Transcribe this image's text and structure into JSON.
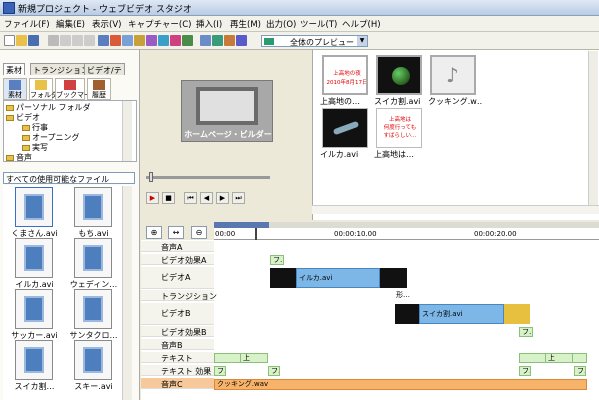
{
  "window": {
    "title": "新規プロジェクト - ウェブビデオ スタジオ"
  },
  "menu": [
    "ファイル(F)",
    "編集(E)",
    "表示(V)",
    "キャプチャー(C)",
    "挿入(I)",
    "再生(M)",
    "出力(O)",
    "ツール(T)",
    "ヘルプ(H)"
  ],
  "toolbar": {
    "preview_select": "全体のプレビュー"
  },
  "left_panel": {
    "tabs": [
      "素材",
      "トランジション",
      "ビデオ/テ"
    ],
    "categories": [
      "素材",
      "フォルダ",
      "ブックマーク",
      "履歴"
    ],
    "tree": [
      "パーソナル フォルダ",
      "ビデオ",
      "行事",
      "オープニング",
      "実写",
      "音声"
    ],
    "filter": "すべての使用可能なファイル",
    "clips": [
      "くまさん.avi",
      "もち.avi",
      "イルカ.avi",
      "ウェディン…",
      "サッカー.avi",
      "サンタクロ…",
      "スイカ割…",
      "スキー.avi"
    ]
  },
  "preview": {
    "caption": "ホームページ・ビルダー"
  },
  "media": [
    {
      "name": "上高地の…",
      "thumb_lines": [
        "上高地の夜",
        "2010年8月17日"
      ]
    },
    {
      "name": "スイカ割.avi",
      "thumb_lines": []
    },
    {
      "name": "クッキング.w…",
      "thumb_lines": []
    },
    {
      "name": "イルカ.avi",
      "thumb_lines": []
    },
    {
      "name": "上高地は…",
      "thumb_lines": [
        "上高地は",
        "何度行っても",
        "すばらしい…"
      ]
    }
  ],
  "timeline": {
    "ruler": [
      "00:00",
      "00:00:10.00",
      "00:00:20.00"
    ],
    "tracks": [
      "音声A",
      "ビデオ効果A",
      "ビデオA",
      "トランジション",
      "ビデオB",
      "ビデオ効果B",
      "音声B",
      "テキスト",
      "テキスト 効果",
      "音声C"
    ],
    "clips": {
      "effectA": "フ…",
      "videoA": "イルカ.avi",
      "transition": "形…",
      "videoB": "スイカ割.avi",
      "effectB": "フ…",
      "text1": "上",
      "text2": "上",
      "texteffect1": "フ…",
      "texteffect2": "フ…",
      "texteffect3": "フ…",
      "texteffect4": "フ…",
      "audioC": "クッキング.wav"
    }
  },
  "colors": {
    "clip_blue": "#7cb7e8",
    "audio_orange": "#f7b36a",
    "effect_green": "#d7f2c8"
  }
}
